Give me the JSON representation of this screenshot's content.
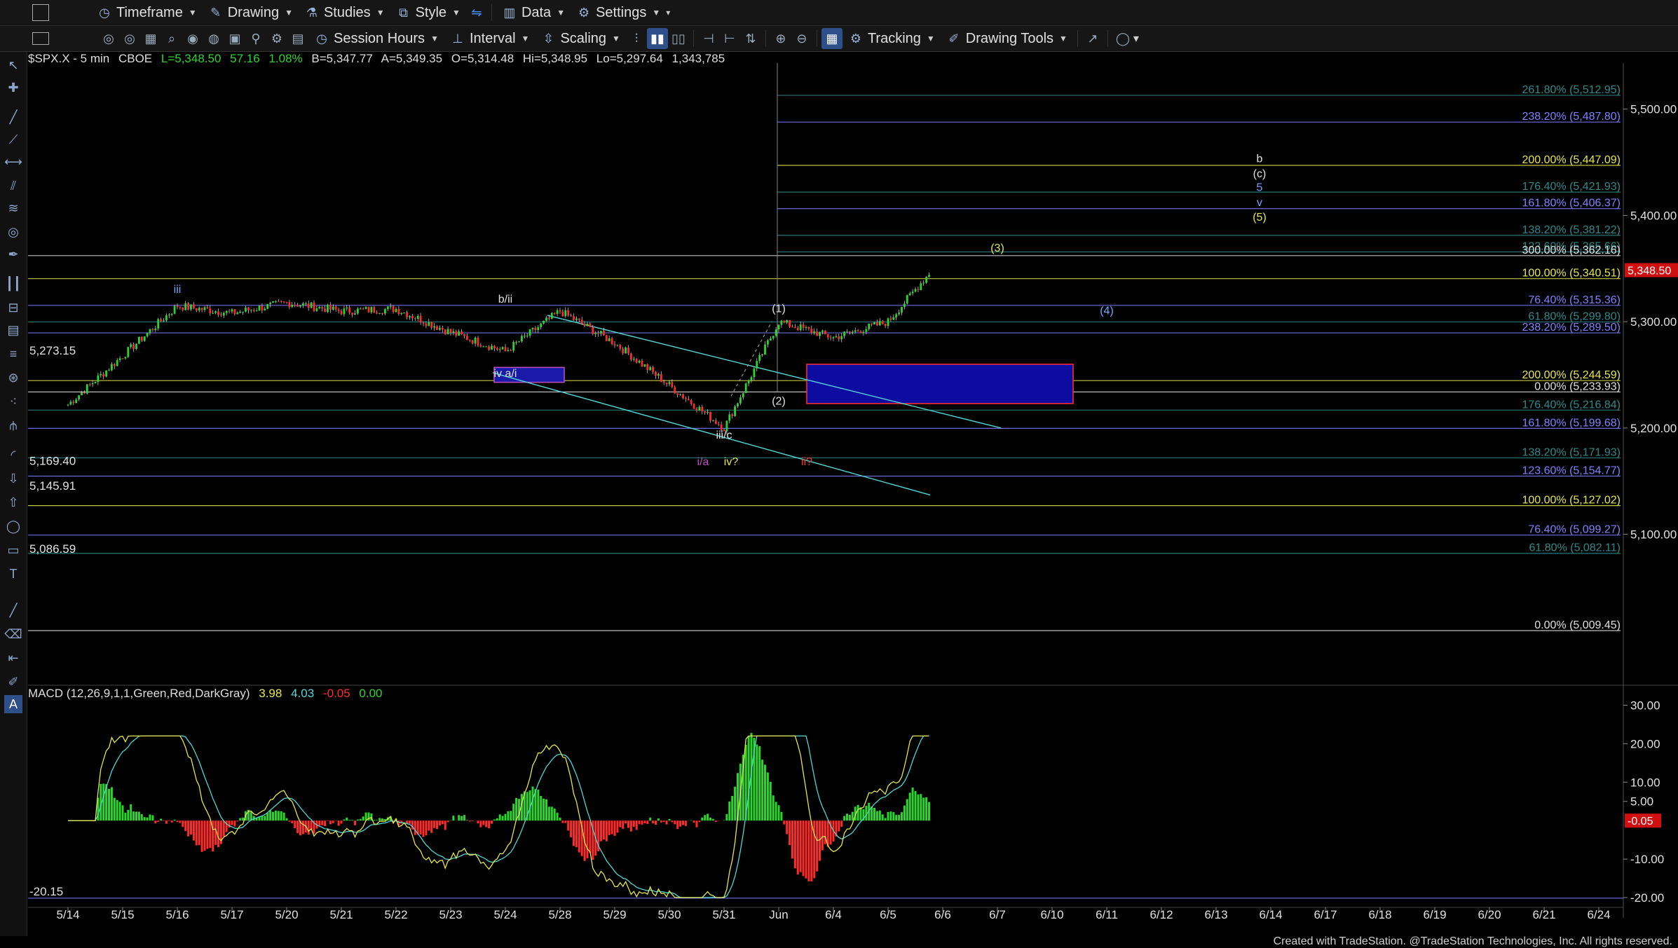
{
  "toolbar1": {
    "items": [
      {
        "label": "Timeframe",
        "icon": "clock-icon"
      },
      {
        "label": "Drawing",
        "icon": "pencil-icon"
      },
      {
        "label": "Studies",
        "icon": "studies-icon"
      },
      {
        "label": "Style",
        "icon": "style-icon"
      },
      {
        "label": "Data",
        "icon": "data-icon"
      },
      {
        "label": "Settings",
        "icon": "gear-icon"
      }
    ]
  },
  "toolbar2": {
    "session_label": "Session Hours",
    "interval_label": "Interval",
    "scaling_label": "Scaling",
    "tracking_label": "Tracking",
    "drawing_tools_label": "Drawing Tools"
  },
  "header": {
    "symbol": "$SPX.X - 5 min",
    "exchange": "CBOE",
    "last": "L=5,348.50",
    "change": "57.16",
    "pct": "1.08%",
    "bid": "B=5,347.77",
    "ask": "A=5,349.35",
    "open": "O=5,314.48",
    "high": "Hi=5,348.95",
    "low": "Lo=5,297.64",
    "volume": "1,343,785"
  },
  "colors": {
    "up": "#2bd52b",
    "down": "#ff2a2a",
    "accent": "#2e4f8a"
  },
  "footer": "Created with TradeStation. @TradeStation Technologies, Inc. All rights reserved.",
  "chart_data": [
    {
      "type": "candlestick",
      "title": "$SPX.X - 5 min",
      "x_labels": [
        "5/14",
        "5/15",
        "5/16",
        "5/17",
        "5/20",
        "5/21",
        "5/22",
        "5/23",
        "5/24",
        "5/28",
        "5/29",
        "5/30",
        "5/31",
        "Jun",
        "6/4",
        "6/5",
        "6/6",
        "6/7",
        "6/10",
        "6/11",
        "6/12",
        "6/13",
        "6/14",
        "6/17",
        "6/18",
        "6/19",
        "6/20",
        "6/21",
        "6/24"
      ],
      "ylim": [
        4960,
        5540
      ],
      "y_ticks": [
        5100,
        5200,
        5300,
        5400,
        5500
      ],
      "y_tick_labels": [
        "5,100.00",
        "5,200.00",
        "5,300.00",
        "5,400.00",
        "5,500.00"
      ],
      "last_price_label": "5,348.50",
      "path_day_close": [
        5222,
        5268,
        5315,
        5308,
        5318,
        5310,
        5312,
        5290,
        5272,
        5310,
        5280,
        5240,
        5200,
        5300,
        5285,
        5300,
        5348.5
      ],
      "left_labels": [
        {
          "text": "5,273.15",
          "value": 5273.15
        },
        {
          "text": "5,169.40",
          "value": 5169.4
        },
        {
          "text": "5,145.91",
          "value": 5145.91
        },
        {
          "text": "5,086.59",
          "value": 5086.59
        }
      ],
      "horizontal_levels": [
        {
          "value": 5512.95,
          "color": "#2e8a8a",
          "label": "261.80% (5,512.95)"
        },
        {
          "value": 5487.8,
          "color": "#8080ff",
          "label": "238.20% (5,487.80)"
        },
        {
          "value": 5447.09,
          "color": "#e6e64a",
          "label": "200.00% (5,447.09)"
        },
        {
          "value": 5421.93,
          "color": "#2e8a8a",
          "label": "176.40% (5,421.93)"
        },
        {
          "value": 5406.37,
          "color": "#8080ff",
          "label": "161.80% (5,406.37)"
        },
        {
          "value": 5381.22,
          "color": "#2e8a8a",
          "label": "138.20% (5,381.22)"
        },
        {
          "value": 5365.66,
          "color": "#2e8a8a",
          "label": "123.60% (5,365.66)"
        },
        {
          "value": 5362.16,
          "color": "#e0e0e0",
          "label": "300.00% (5,362.16)"
        },
        {
          "value": 5340.51,
          "color": "#e6e64a",
          "label": "100.00% (5,340.51)"
        },
        {
          "value": 5315.36,
          "color": "#8080ff",
          "label": "76.40% (5,315.36)"
        },
        {
          "value": 5299.8,
          "color": "#2e8a8a",
          "label": "61.80% (5,299.80)"
        },
        {
          "value": 5289.5,
          "color": "#8080ff",
          "label": "238.20% (5,289.50)"
        },
        {
          "value": 5244.59,
          "color": "#e6e64a",
          "label": "200.00% (5,244.59)"
        },
        {
          "value": 5233.93,
          "color": "#e0e0e0",
          "label": "0.00% (5,233.93)"
        },
        {
          "value": 5216.84,
          "color": "#2e8a8a",
          "label": "176.40% (5,216.84)"
        },
        {
          "value": 5199.68,
          "color": "#8080ff",
          "label": "161.80% (5,199.68)"
        },
        {
          "value": 5171.93,
          "color": "#2e8a8a",
          "label": "138.20% (5,171.93)"
        },
        {
          "value": 5154.77,
          "color": "#8080ff",
          "label": "123.60% (5,154.77)"
        },
        {
          "value": 5127.02,
          "color": "#e6e64a",
          "label": "100.00% (5,127.02)"
        },
        {
          "value": 5099.27,
          "color": "#8080ff",
          "label": "76.40% (5,099.27)"
        },
        {
          "value": 5082.11,
          "color": "#2e8a8a",
          "label": "61.80% (5,082.11)"
        },
        {
          "value": 5009.45,
          "color": "#e0e0e0",
          "label": "0.00% (5,009.45)"
        }
      ],
      "annotations": [
        {
          "text": "iii",
          "x": "5/16",
          "value": 5327,
          "color": "#6fa8ff"
        },
        {
          "text": "b/ii",
          "x": "5/24",
          "value": 5318,
          "color": "#e0e0e0"
        },
        {
          "text": "iv a/i",
          "x": "5/24",
          "value": 5248,
          "color": "#e0e0e0"
        },
        {
          "text": "iii/c",
          "x": "5/31",
          "value": 5190,
          "color": "#e0e0e0"
        },
        {
          "text": "i/a",
          "x": "5/31",
          "value": 5165,
          "color": "#c050c0"
        },
        {
          "text": "iv?",
          "x": "5/31",
          "value": 5165,
          "color": "#e6e64a"
        },
        {
          "text": "ii?",
          "x": "Jun",
          "value": 5165,
          "color": "#ff3030"
        },
        {
          "text": "(1)",
          "x": "Jun",
          "value": 5309,
          "color": "#e0e0e0"
        },
        {
          "text": "(2)",
          "x": "Jun",
          "value": 5222,
          "color": "#e0e0e0"
        },
        {
          "text": "(3)",
          "x": "6/7",
          "value": 5366,
          "color": "#e6e64a"
        },
        {
          "text": "(4)",
          "x": "6/11",
          "value": 5307,
          "color": "#6fa8ff"
        },
        {
          "text": "b",
          "x": "6/14",
          "value": 5450,
          "color": "#e0e0e0"
        },
        {
          "text": "(c)",
          "x": "6/14",
          "value": 5436,
          "color": "#e0e0e0"
        },
        {
          "text": "5",
          "x": "6/14",
          "value": 5423,
          "color": "#6fa8ff"
        },
        {
          "text": "v",
          "x": "6/14",
          "value": 5409,
          "color": "#6fa8ff"
        },
        {
          "text": "(5)",
          "x": "6/14",
          "value": 5395,
          "color": "#e6e64a"
        }
      ]
    },
    {
      "type": "line",
      "title": "MACD (12,26,9,1,1,Green,Red,DarkGray)",
      "values_text": [
        "3.98",
        "4.03",
        "-0.05",
        "0.00"
      ],
      "ylim": [
        -22,
        33
      ],
      "y_ticks": [
        30,
        20,
        10,
        5,
        -10,
        -20
      ],
      "y_tick_labels": [
        "30.00",
        "20.00",
        "10.00",
        "5.00",
        "-10.00",
        "-20.00"
      ],
      "current_label": "-0.05",
      "min_label": "-20.15",
      "series": [
        {
          "name": "MACD",
          "color": "#e6e64a"
        },
        {
          "name": "Signal",
          "color": "#4fd6d6"
        }
      ]
    }
  ]
}
